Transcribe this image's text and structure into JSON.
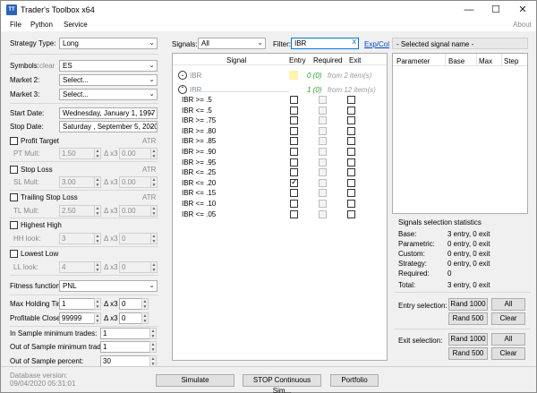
{
  "window": {
    "title": "Trader's Toolbox x64",
    "icon": "TT",
    "minimize": "—",
    "maximize": "☐",
    "close": "✕"
  },
  "menu": {
    "file": "File",
    "python": "Python",
    "service": "Service",
    "about": "About"
  },
  "left": {
    "strategy_type_label": "Strategy Type:",
    "strategy_type": "Long",
    "symbols_label": "Symbols:",
    "clear": "clear",
    "symbol": "ES",
    "market2_label": "Market 2:",
    "market2": "Select...",
    "market3_label": "Market 3:",
    "market3": "Select...",
    "start_date_label": "Start Date:",
    "start_date": "Wednesday,  January    1, 1997",
    "stop_date_label": "Stop Date:",
    "stop_date": "Saturday  , September  5, 2020",
    "profit_target": "Profit Target",
    "atr": "ATR",
    "pt_mult": "PT Mult:",
    "pt_val": "1.50",
    "dx3": "Δ x3",
    "pt_delta": "0.00",
    "stop_loss": "Stop Loss",
    "sl_mult": "SL Mult:",
    "sl_val": "3.00",
    "sl_delta": "0.00",
    "trailing_stop": "Trailing Stop Loss",
    "tl_mult": "TL Mult:",
    "tl_val": "2.50",
    "tl_delta": "0.00",
    "highest_high": "Highest High",
    "hh_look": "HH look:",
    "hh_val": "3",
    "hh_delta": "0",
    "lowest_low": "Lowest Low",
    "ll_look": "LL look:",
    "ll_val": "4",
    "ll_delta": "0",
    "fitness_label": "Fitness function:",
    "fitness": "PNL",
    "max_hold_label": "Max Holding Time:",
    "max_hold": "1",
    "max_hold_delta": "0",
    "prof_closes_label": "Profitable Closes:",
    "prof_closes": "99999",
    "prof_closes_delta": "0",
    "in_sample_label": "In Sample minimum trades:",
    "in_sample": "1",
    "out_sample_label": "Out of Sample minimum trades:",
    "out_sample": "1",
    "out_pct_label": "Out of Sample percent:",
    "out_pct": "30"
  },
  "signals": {
    "label": "Signals:",
    "value": "All",
    "filter_label": "Filter:",
    "filter_value": "IBR",
    "filter_clear": "X",
    "exp_col": "Exp/Col",
    "col_signal": "Signal",
    "col_entry": "Entry",
    "col_required": "Required",
    "col_exit": "Exit",
    "group1": {
      "name": "IBR",
      "count": "0 (0)",
      "from": "from 2 item(s)"
    },
    "group2": {
      "name": "IBR",
      "count": "1 (0)",
      "from": "from 12 item(s)"
    },
    "items": [
      {
        "name": "IBR >= .5",
        "entry": false
      },
      {
        "name": "IBR <= .5",
        "entry": false
      },
      {
        "name": "IBR >= .75",
        "entry": false
      },
      {
        "name": "IBR >= .80",
        "entry": false
      },
      {
        "name": "IBR >= .85",
        "entry": false
      },
      {
        "name": "IBR >= .90",
        "entry": false
      },
      {
        "name": "IBR >= .95",
        "entry": false
      },
      {
        "name": "IBR <= .25",
        "entry": false
      },
      {
        "name": "IBR <= .20",
        "entry": true
      },
      {
        "name": "IBR <= .15",
        "entry": false
      },
      {
        "name": "IBR <= .10",
        "entry": false
      },
      {
        "name": "IBR <= .05",
        "entry": false
      }
    ]
  },
  "right": {
    "selected_title": "- Selected signal name -",
    "col_parameter": "Parameter",
    "col_base": "Base",
    "col_max": "Max",
    "col_step": "Step",
    "stats_title": "Signals selection statistics",
    "stats": [
      {
        "label": "Base:",
        "value": "3 entry, 0 exit"
      },
      {
        "label": "Parametric:",
        "value": "0 entry, 0 exit"
      },
      {
        "label": "Custom:",
        "value": "0 entry, 0 exit"
      },
      {
        "label": "Strategy:",
        "value": "0 entry, 0 exit"
      },
      {
        "label": "Required:",
        "value": "0"
      }
    ],
    "total_label": "Total:",
    "total_value": "3 entry, 0 exit",
    "entry_sel": "Entry selection:",
    "exit_sel": "Exit selection:",
    "rand1000": "Rand 1000",
    "rand500": "Rand 500",
    "all": "All",
    "clear": "Clear"
  },
  "bottom": {
    "db_label": "Database version:",
    "db_value": "09/04/2020 05:31:01",
    "simulate": "Simulate",
    "stop_sim": "STOP Continuous Sim...",
    "portfolio": "Portfolio"
  }
}
